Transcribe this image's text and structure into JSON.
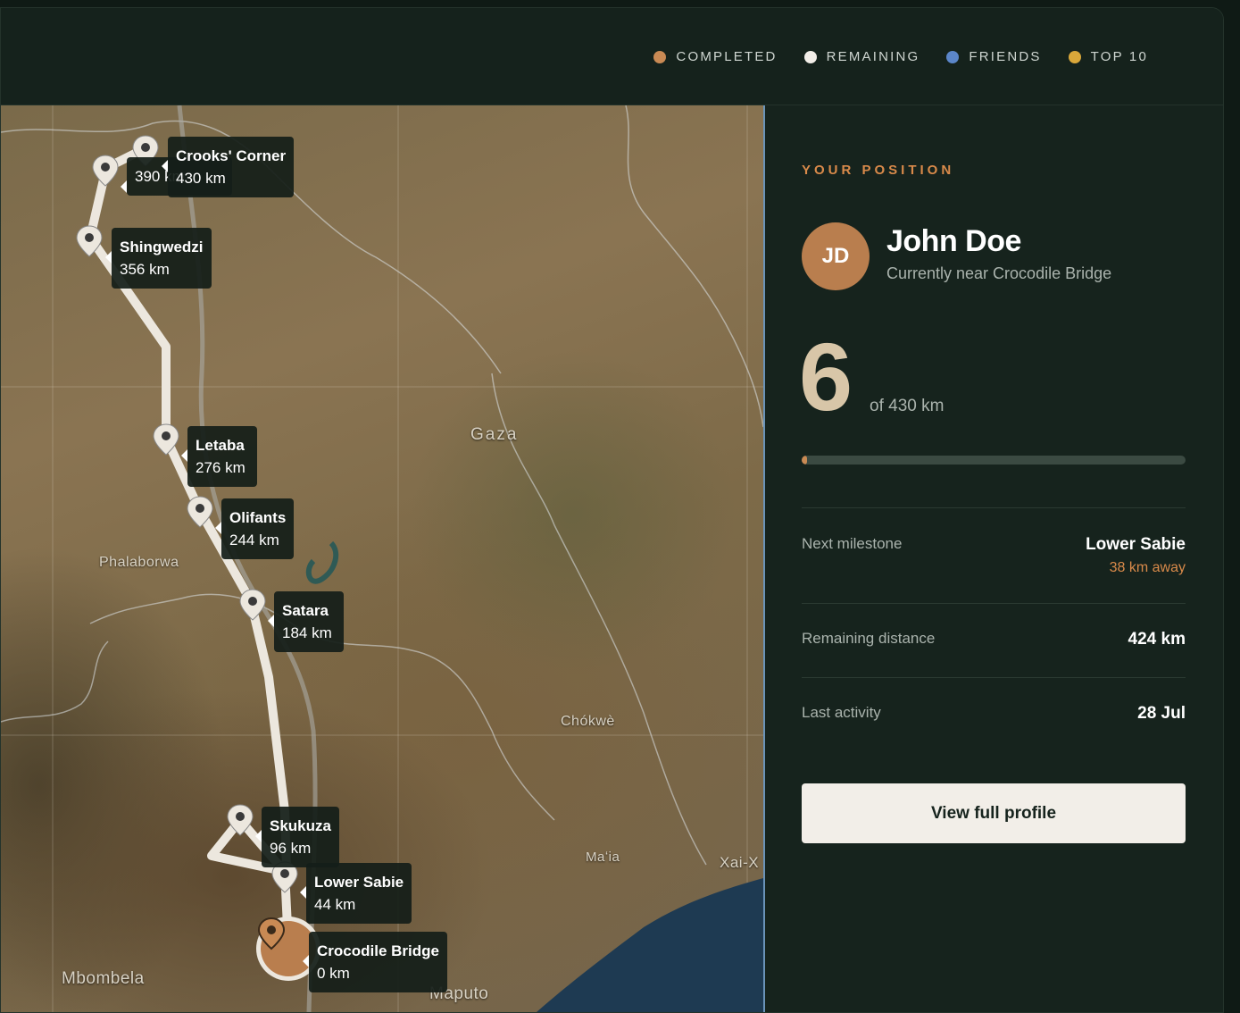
{
  "legend": [
    {
      "label": "COMPLETED",
      "color": "#c98a54"
    },
    {
      "label": "REMAINING",
      "color": "#f2eee8"
    },
    {
      "label": "FRIENDS",
      "color": "#5b86c9"
    },
    {
      "label": "TOP 10",
      "color": "#d9a73a"
    }
  ],
  "map": {
    "places": [
      "Gaza",
      "Phalaborwa",
      "Chókwè",
      "Maʻia",
      "Xai-X",
      "Mbombela",
      "Maputo"
    ],
    "milestones": [
      {
        "name": "Crooks' Corner",
        "km": "430 km"
      },
      {
        "name": "",
        "km": "390 km"
      },
      {
        "name": "Shingwedzi",
        "km": "356 km"
      },
      {
        "name": "Letaba",
        "km": "276 km"
      },
      {
        "name": "Olifants",
        "km": "244 km"
      },
      {
        "name": "Satara",
        "km": "184 km"
      },
      {
        "name": "Skukuza",
        "km": "96 km"
      },
      {
        "name": "Lower Sabie",
        "km": "44 km"
      },
      {
        "name": "Crocodile Bridge",
        "km": "0 km"
      }
    ]
  },
  "panel": {
    "eyebrow": "YOUR POSITION",
    "initials": "JD",
    "name": "John Doe",
    "near": "Currently near Crocodile Bridge",
    "distance_done": "6",
    "of_total": "of 430 km",
    "progress_fraction": 0.014,
    "next_milestone_label": "Next milestone",
    "next_milestone_value": "Lower Sabie",
    "next_milestone_away": "38 km away",
    "remaining_label": "Remaining distance",
    "remaining_value": "424 km",
    "activity_label": "Last activity",
    "activity_value": "28 Jul",
    "button": "View full profile"
  }
}
